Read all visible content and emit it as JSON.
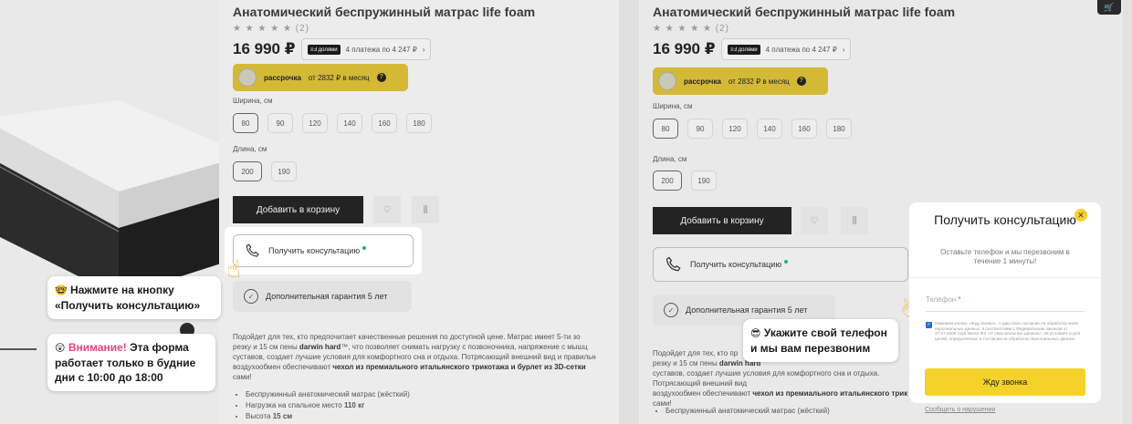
{
  "product": {
    "title": "Анатомический беспружинный матрас life foam",
    "stars": "★ ★ ★ ★ ★",
    "reviews": "(2)",
    "price": "16 990 ₽",
    "dolyami_tag": "≡Ⅎ долями",
    "dolyami_text": "4 платежа по 4 247 ₽",
    "installment_label": "рассрочка",
    "installment_text": "от 2832 ₽ в месяц",
    "width_label": "Ширина, см",
    "widths": [
      "80",
      "90",
      "120",
      "140",
      "160",
      "180"
    ],
    "length_label": "Длина, см",
    "lengths": [
      "200",
      "190"
    ],
    "add_to_cart": "Добавить в корзину",
    "consult": "Получить консультацию",
    "guarantee": "Дополнительная гарантия 5 лет",
    "desc_1": "Подойдет для тех, кто предпочитает качественные решения по доступной цене. Матрас имеет 5-ти зо",
    "desc_2a": "резку и 15 см пены ",
    "desc_2b": "darwin hard",
    "desc_2c": "™, что позволяет снимать нагрузку с позвоночника, напряжение с мышц",
    "desc_3": "суставов, создает лучшие условия для комфортного сна и отдыха. Потрясающий внешний вид и правильн",
    "desc_4a": "воздухообмен обеспечивают ",
    "desc_4b": "чехол из премиального итальянского трикотажа и бурлет из 3D-сетки",
    "desc_5": "сами!",
    "bullets": [
      "Беспружинный анатомический матрас (жёсткий)",
      "Нагрузка на спальное место 110 кг",
      "Высота 15 см"
    ],
    "bullets_values": [
      "",
      "",
      ""
    ],
    "p2_desc_1": "Подойдет для тех, кто пр",
    "p2_desc_2a": "резку и 15 см пены ",
    "p2_desc_2b": "darwin hard",
    "p2_desc_3": "суставов, создает лучшие условия для комфортного сна и отдыха. Потрясающий внешний вид",
    "p2_desc_4a": "воздухообмен обеспечивают ",
    "p2_desc_4b": "чехол из премиального итальянского трик",
    "p2_desc_5": "сами!",
    "p2_bullet": "Беспружинный анатомический матрас (жёсткий)"
  },
  "tooltips": {
    "press_emoji": "🤓",
    "press_text": "Нажмите на кнопку «Получить консультацию»",
    "attention_emoji": "😲",
    "attention_warn": "Внимание!",
    "attention_text": " Эта форма работает только в будние дни с 10:00 до 18:00",
    "phone_emoji": "😎",
    "phone_text": "Укажите свой телефон и мы вам перезвоним"
  },
  "modal": {
    "title": "Получить консультацию",
    "subtitle": "Оставьте телефон и мы перезвоним в течение 1 минуты!",
    "phone_placeholder": "Телефон",
    "required_mark": "*",
    "consent": "Нажимая кнопку «Жду звонка», я даю свое согласие на обработку моих персональных данных, в соответствии с Федеральным законом от 27.07.2006 года №152-ФЗ «О персональных данных», на условиях и для целей, определенных в Согласии на обработку персональных данных",
    "call_button": "Жду звонка",
    "report": "Сообщить о нарушении"
  }
}
